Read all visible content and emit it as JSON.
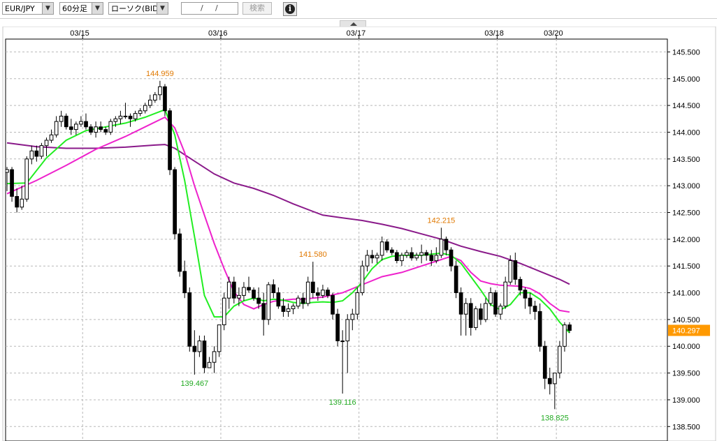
{
  "toolbar": {
    "symbol": "EUR/JPY",
    "timeframe": "60分足",
    "chart_type": "ローソク(BID)",
    "date_placeholder": [
      "",
      "/",
      "/"
    ],
    "search_label": "検索",
    "info_glyph": "i",
    "dropdown_icon": "▼"
  },
  "colors": {
    "grid": "#b8b8b8",
    "candle": "#000000",
    "ma_short": "#22ee22",
    "ma_mid": "#ee22cc",
    "ma_long": "#8a1a8a",
    "high_label": "#e07800",
    "low_label": "#22aa22",
    "price_tag_bg": "#ff9900"
  },
  "chart_data": {
    "type": "candlestick",
    "x_labels": [
      "03/15",
      "03/16",
      "03/17",
      "03/18",
      "03/20"
    ],
    "y_ticks": [
      "145.500",
      "145.000",
      "144.500",
      "144.000",
      "143.500",
      "143.000",
      "142.500",
      "142.000",
      "141.500",
      "141.000",
      "140.500",
      "140.000",
      "139.500",
      "139.000",
      "138.500"
    ],
    "ylim": [
      138.3,
      145.6
    ],
    "current_price": "140.297",
    "annotations": [
      {
        "text": "144.959",
        "value": 144.959,
        "kind": "high"
      },
      {
        "text": "139.467",
        "value": 139.467,
        "kind": "low"
      },
      {
        "text": "141.580",
        "value": 141.58,
        "kind": "high"
      },
      {
        "text": "139.116",
        "value": 139.116,
        "kind": "low"
      },
      {
        "text": "142.215",
        "value": 142.215,
        "kind": "high"
      },
      {
        "text": "138.825",
        "value": 138.825,
        "kind": "low"
      }
    ],
    "candles": [
      [
        143.25,
        143.35,
        142.9,
        143.3
      ],
      [
        143.3,
        143.35,
        142.7,
        142.8
      ],
      [
        142.8,
        142.95,
        142.5,
        142.6
      ],
      [
        142.6,
        143.0,
        142.55,
        142.75
      ],
      [
        142.75,
        143.55,
        142.7,
        143.5
      ],
      [
        143.5,
        143.75,
        143.4,
        143.65
      ],
      [
        143.65,
        143.75,
        143.45,
        143.55
      ],
      [
        143.55,
        143.8,
        143.5,
        143.75
      ],
      [
        143.75,
        143.9,
        143.55,
        143.85
      ],
      [
        143.85,
        144.05,
        143.8,
        143.95
      ],
      [
        143.95,
        144.3,
        143.9,
        144.2
      ],
      [
        144.2,
        144.4,
        144.1,
        144.3
      ],
      [
        144.3,
        144.35,
        144.05,
        144.1
      ],
      [
        144.1,
        144.25,
        143.95,
        144.05
      ],
      [
        144.05,
        144.2,
        143.95,
        144.15
      ],
      [
        144.15,
        144.3,
        144.1,
        144.2
      ],
      [
        144.2,
        144.35,
        144.05,
        144.1
      ],
      [
        144.1,
        144.15,
        143.95,
        144.0
      ],
      [
        144.0,
        144.2,
        143.9,
        144.1
      ],
      [
        144.1,
        144.2,
        144.0,
        144.05
      ],
      [
        144.05,
        144.1,
        143.95,
        144.0
      ],
      [
        144.0,
        144.25,
        143.95,
        144.2
      ],
      [
        144.2,
        144.3,
        144.1,
        144.25
      ],
      [
        144.25,
        144.4,
        144.15,
        144.3
      ],
      [
        144.3,
        144.55,
        144.25,
        144.3
      ],
      [
        144.3,
        144.35,
        144.1,
        144.25
      ],
      [
        144.25,
        144.4,
        144.2,
        144.35
      ],
      [
        144.35,
        144.45,
        144.3,
        144.4
      ],
      [
        144.4,
        144.55,
        144.35,
        144.5
      ],
      [
        144.5,
        144.7,
        144.45,
        144.6
      ],
      [
        144.6,
        144.75,
        144.55,
        144.7
      ],
      [
        144.7,
        144.96,
        144.6,
        144.85
      ],
      [
        144.85,
        144.9,
        144.3,
        144.4
      ],
      [
        144.4,
        144.45,
        143.2,
        143.3
      ],
      [
        143.3,
        143.35,
        142.0,
        142.1
      ],
      [
        142.1,
        142.2,
        141.3,
        141.4
      ],
      [
        141.4,
        141.6,
        140.9,
        141.0
      ],
      [
        141.0,
        141.1,
        139.9,
        140.0
      ],
      [
        140.0,
        140.3,
        139.47,
        139.9
      ],
      [
        139.9,
        140.2,
        139.8,
        140.1
      ],
      [
        140.1,
        140.2,
        139.5,
        139.6
      ],
      [
        139.6,
        139.7,
        139.8,
        139.7
      ],
      [
        139.7,
        140.0,
        139.5,
        139.9
      ],
      [
        139.9,
        140.4,
        139.8,
        140.4
      ],
      [
        140.4,
        141.0,
        140.3,
        140.9
      ],
      [
        140.9,
        141.3,
        140.7,
        141.2
      ],
      [
        141.2,
        141.3,
        140.8,
        140.9
      ],
      [
        140.9,
        141.1,
        140.75,
        140.95
      ],
      [
        140.95,
        141.2,
        140.85,
        141.1
      ],
      [
        141.1,
        141.3,
        141.0,
        141.05
      ],
      [
        141.05,
        141.1,
        140.85,
        140.9
      ],
      [
        140.9,
        141.1,
        140.7,
        140.8
      ],
      [
        140.8,
        141.0,
        140.2,
        140.5
      ],
      [
        140.5,
        141.2,
        140.4,
        141.15
      ],
      [
        141.15,
        141.25,
        140.9,
        141.0
      ],
      [
        141.0,
        141.1,
        140.7,
        140.75
      ],
      [
        140.75,
        140.9,
        140.55,
        140.65
      ],
      [
        140.65,
        140.8,
        140.55,
        140.7
      ],
      [
        140.7,
        140.8,
        140.6,
        140.75
      ],
      [
        140.75,
        140.95,
        140.7,
        140.9
      ],
      [
        140.9,
        141.0,
        140.7,
        140.8
      ],
      [
        140.8,
        141.3,
        140.75,
        141.2
      ],
      [
        141.2,
        141.58,
        140.9,
        141.0
      ],
      [
        141.0,
        141.1,
        140.85,
        140.95
      ],
      [
        140.95,
        141.15,
        140.9,
        141.05
      ],
      [
        141.05,
        141.1,
        140.9,
        140.95
      ],
      [
        140.95,
        141.0,
        140.5,
        140.6
      ],
      [
        140.6,
        140.7,
        140.0,
        140.1
      ],
      [
        140.1,
        140.3,
        139.116,
        140.1
      ],
      [
        140.1,
        140.6,
        139.5,
        140.5
      ],
      [
        140.5,
        140.7,
        140.3,
        140.6
      ],
      [
        140.6,
        141.1,
        140.5,
        141.0
      ],
      [
        141.0,
        141.6,
        140.95,
        141.5
      ],
      [
        141.5,
        141.8,
        141.4,
        141.7
      ],
      [
        141.7,
        141.8,
        141.55,
        141.65
      ],
      [
        141.65,
        141.75,
        141.55,
        141.7
      ],
      [
        141.7,
        142.05,
        141.6,
        141.95
      ],
      [
        141.95,
        142.0,
        141.75,
        141.8
      ],
      [
        141.8,
        141.85,
        141.7,
        141.75
      ],
      [
        141.75,
        141.8,
        141.55,
        141.6
      ],
      [
        141.6,
        141.75,
        141.5,
        141.7
      ],
      [
        141.7,
        141.8,
        141.65,
        141.75
      ],
      [
        141.75,
        141.85,
        141.6,
        141.65
      ],
      [
        141.65,
        141.75,
        141.6,
        141.7
      ],
      [
        141.7,
        141.9,
        141.55,
        141.75
      ],
      [
        141.75,
        141.8,
        141.6,
        141.7
      ],
      [
        141.7,
        141.8,
        141.5,
        141.6
      ],
      [
        141.6,
        141.85,
        141.55,
        141.7
      ],
      [
        141.7,
        142.215,
        141.65,
        142.0
      ],
      [
        142.0,
        142.05,
        141.7,
        141.8
      ],
      [
        141.8,
        141.85,
        141.4,
        141.5
      ],
      [
        141.5,
        141.6,
        140.9,
        141.0
      ],
      [
        141.0,
        141.1,
        140.2,
        140.6
      ],
      [
        140.6,
        140.9,
        140.2,
        140.8
      ],
      [
        140.8,
        140.9,
        140.2,
        140.35
      ],
      [
        140.35,
        140.75,
        140.3,
        140.7
      ],
      [
        140.7,
        140.8,
        140.4,
        140.5
      ],
      [
        140.5,
        140.9,
        140.45,
        140.8
      ],
      [
        140.8,
        141.1,
        140.75,
        141.0
      ],
      [
        141.0,
        141.05,
        140.55,
        140.6
      ],
      [
        140.6,
        140.8,
        140.5,
        140.75
      ],
      [
        140.75,
        141.3,
        140.7,
        141.2
      ],
      [
        141.2,
        141.7,
        141.15,
        141.6
      ],
      [
        141.6,
        141.75,
        141.15,
        141.25
      ],
      [
        141.25,
        141.3,
        140.95,
        141.05
      ],
      [
        141.05,
        141.1,
        140.7,
        140.9
      ],
      [
        140.9,
        141.0,
        140.6,
        140.75
      ],
      [
        140.75,
        140.85,
        140.5,
        140.65
      ],
      [
        140.65,
        140.8,
        139.9,
        140.0
      ],
      [
        140.0,
        140.1,
        139.2,
        139.4
      ],
      [
        139.4,
        139.6,
        139.1,
        139.3
      ],
      [
        139.3,
        139.5,
        138.825,
        139.5
      ],
      [
        139.5,
        140.1,
        139.4,
        140.0
      ],
      [
        140.0,
        140.45,
        139.9,
        140.4
      ],
      [
        140.4,
        140.45,
        140.25,
        140.297
      ]
    ],
    "ma_short": [
      [
        0,
        143.04
      ],
      [
        4,
        143.05
      ],
      [
        8,
        143.52
      ],
      [
        12,
        143.85
      ],
      [
        16,
        144.03
      ],
      [
        20,
        144.1
      ],
      [
        24,
        144.17
      ],
      [
        28,
        144.28
      ],
      [
        30,
        144.35
      ],
      [
        32,
        144.42
      ],
      [
        34,
        143.95
      ],
      [
        36,
        143.1
      ],
      [
        38,
        142.05
      ],
      [
        40,
        140.95
      ],
      [
        42,
        140.55
      ],
      [
        44,
        140.55
      ],
      [
        46,
        140.75
      ],
      [
        48,
        140.85
      ],
      [
        50,
        140.9
      ],
      [
        52,
        140.85
      ],
      [
        54,
        140.88
      ],
      [
        56,
        140.86
      ],
      [
        58,
        140.82
      ],
      [
        60,
        140.8
      ],
      [
        62,
        140.82
      ],
      [
        64,
        140.83
      ],
      [
        66,
        140.82
      ],
      [
        68,
        140.85
      ],
      [
        70,
        141.0
      ],
      [
        72,
        141.2
      ],
      [
        74,
        141.45
      ],
      [
        76,
        141.62
      ],
      [
        78,
        141.68
      ],
      [
        80,
        141.7
      ],
      [
        82,
        141.7
      ],
      [
        84,
        141.7
      ],
      [
        86,
        141.72
      ],
      [
        88,
        141.74
      ],
      [
        90,
        141.7
      ],
      [
        92,
        141.55
      ],
      [
        94,
        141.3
      ],
      [
        96,
        141.05
      ],
      [
        98,
        140.78
      ],
      [
        100,
        140.68
      ],
      [
        102,
        140.78
      ],
      [
        104,
        141.0
      ],
      [
        106,
        141.0
      ],
      [
        108,
        140.88
      ],
      [
        110,
        140.7
      ],
      [
        112,
        140.45
      ],
      [
        114,
        140.25
      ]
    ],
    "ma_mid": [
      [
        0,
        142.85
      ],
      [
        6,
        143.1
      ],
      [
        12,
        143.38
      ],
      [
        18,
        143.68
      ],
      [
        24,
        143.92
      ],
      [
        28,
        144.1
      ],
      [
        32,
        144.28
      ],
      [
        34,
        144.08
      ],
      [
        36,
        143.62
      ],
      [
        38,
        143.0
      ],
      [
        40,
        142.45
      ],
      [
        42,
        141.92
      ],
      [
        44,
        141.45
      ],
      [
        46,
        141.02
      ],
      [
        48,
        140.78
      ],
      [
        50,
        140.7
      ],
      [
        52,
        140.78
      ],
      [
        54,
        140.84
      ],
      [
        56,
        140.86
      ],
      [
        58,
        140.88
      ],
      [
        60,
        140.88
      ],
      [
        64,
        140.92
      ],
      [
        68,
        141.0
      ],
      [
        72,
        141.15
      ],
      [
        76,
        141.3
      ],
      [
        80,
        141.38
      ],
      [
        84,
        141.5
      ],
      [
        88,
        141.62
      ],
      [
        90,
        141.68
      ],
      [
        92,
        141.6
      ],
      [
        94,
        141.38
      ],
      [
        96,
        141.22
      ],
      [
        98,
        141.17
      ],
      [
        100,
        141.14
      ],
      [
        104,
        141.12
      ],
      [
        106,
        141.08
      ],
      [
        108,
        140.98
      ],
      [
        110,
        140.8
      ],
      [
        112,
        140.67
      ],
      [
        114,
        140.64
      ]
    ],
    "ma_long": [
      [
        0,
        143.8
      ],
      [
        6,
        143.73
      ],
      [
        12,
        143.7
      ],
      [
        18,
        143.7
      ],
      [
        24,
        143.72
      ],
      [
        30,
        143.76
      ],
      [
        32,
        143.77
      ],
      [
        34,
        143.7
      ],
      [
        38,
        143.46
      ],
      [
        42,
        143.22
      ],
      [
        46,
        143.05
      ],
      [
        50,
        142.95
      ],
      [
        54,
        142.82
      ],
      [
        58,
        142.66
      ],
      [
        62,
        142.52
      ],
      [
        64,
        142.45
      ],
      [
        68,
        142.4
      ],
      [
        72,
        142.35
      ],
      [
        76,
        142.28
      ],
      [
        80,
        142.2
      ],
      [
        84,
        142.1
      ],
      [
        88,
        142.0
      ],
      [
        92,
        141.87
      ],
      [
        96,
        141.77
      ],
      [
        100,
        141.68
      ],
      [
        104,
        141.55
      ],
      [
        108,
        141.4
      ],
      [
        112,
        141.25
      ],
      [
        114,
        141.16
      ]
    ]
  }
}
